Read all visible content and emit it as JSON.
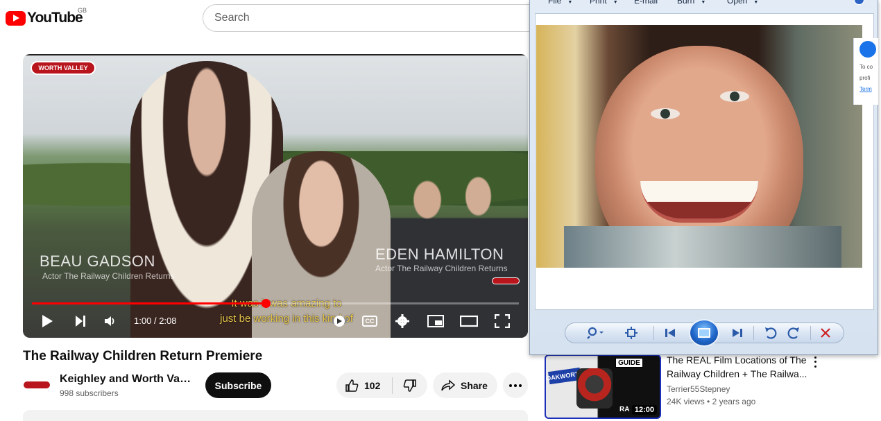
{
  "header": {
    "logo_text": "YouTube",
    "region": "GB",
    "search_placeholder": "Search"
  },
  "player": {
    "overlay_badge": "WORTH VALLEY",
    "lower_third_left_name": "BEAU GADSON",
    "lower_third_left_role": "Actor The Railway Children Returns",
    "lower_third_right_name": "EDEN HAMILTON",
    "lower_third_right_role": "Actor The Railway Children Returns",
    "caption_line1": "It was it was amazing to",
    "caption_line2": "just be working in this kind of",
    "progress_fraction": 0.48,
    "time_current": "1:00",
    "time_separator": "/",
    "time_total": "2:08",
    "cc_label": "CC"
  },
  "video": {
    "title": "The Railway Children Return Premiere",
    "channel_name": "Keighley and Worth Vall...",
    "subscribers": "998 subscribers",
    "subscribe_label": "Subscribe",
    "like_count": "102",
    "share_label": "Share"
  },
  "photo_viewer": {
    "menu": [
      "File",
      "Print",
      "E-mail",
      "Burn",
      "Open"
    ],
    "side_panel_lines": [
      "To co",
      "profi",
      "Term"
    ]
  },
  "recommendation": {
    "title_line1": "The REAL Film Locations of The",
    "title_line2": "Railway Children + The Railwa...",
    "channel": "Terrier55Stepney",
    "views": "24K views",
    "age": "2 years ago",
    "meta_separator": "•",
    "duration": "12:00",
    "thumb_sign": "OAKWORTH",
    "thumb_guide": "GUIDE",
    "thumb_bottom_text": "RA"
  },
  "colors": {
    "youtube_red": "#ff0000",
    "progress_red": "#ff0000",
    "subscribe_bg": "#0f0f0f",
    "viewer_frame": "#d6e2ef",
    "caption_yellow": "#e5c44a"
  }
}
